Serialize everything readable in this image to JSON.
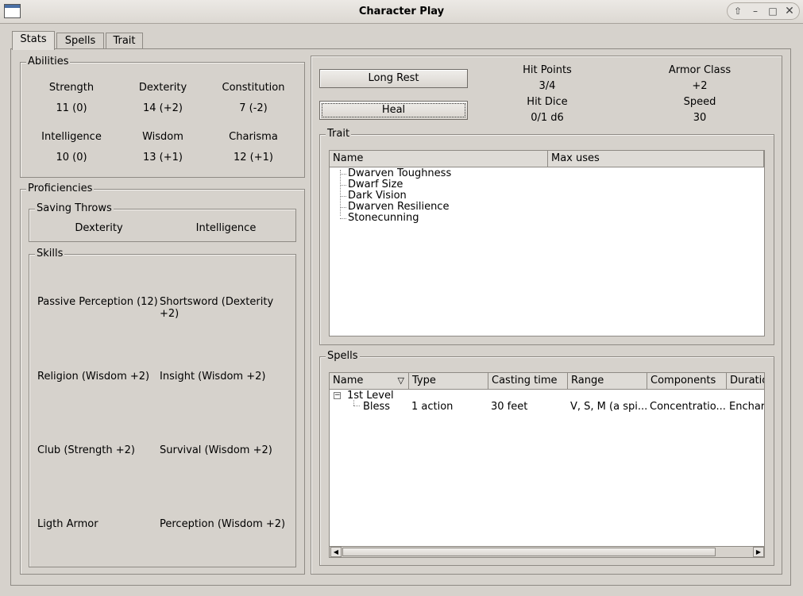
{
  "window": {
    "title": "Character Play"
  },
  "tabs": [
    {
      "label": "Stats"
    },
    {
      "label": "Spells"
    },
    {
      "label": "Trait"
    }
  ],
  "abilities": {
    "title": "Abilities",
    "items": [
      {
        "name": "Strength",
        "value": "11 (0)"
      },
      {
        "name": "Dexterity",
        "value": "14 (+2)"
      },
      {
        "name": "Constitution",
        "value": "7 (-2)"
      },
      {
        "name": "Intelligence",
        "value": "10 (0)"
      },
      {
        "name": "Wisdom",
        "value": "13 (+1)"
      },
      {
        "name": "Charisma",
        "value": "12 (+1)"
      }
    ]
  },
  "proficiencies": {
    "title": "Proficiencies",
    "saving_throws": {
      "title": "Saving Throws",
      "items": [
        "Dexterity",
        "Intelligence"
      ]
    },
    "skills": {
      "title": "Skills",
      "items": [
        "Passive Perception (12)",
        "Shortsword (Dexterity +2)",
        "Religion (Wisdom +2)",
        "Insight (Wisdom +2)",
        "Club (Strength +2)",
        "Survival (Wisdom +2)",
        "Ligth Armor",
        "Perception (Wisdom +2)"
      ]
    }
  },
  "actions": {
    "long_rest": "Long Rest",
    "heal": "Heal"
  },
  "status": {
    "hit_points_label": "Hit Points",
    "hit_points": "3/4",
    "armor_class_label": "Armor Class",
    "armor_class": "+2",
    "hit_dice_label": "Hit Dice",
    "hit_dice": "0/1 d6",
    "speed_label": "Speed",
    "speed": "30"
  },
  "trait_panel": {
    "title": "Trait",
    "columns": [
      "Name",
      "Max uses"
    ],
    "rows": [
      "Dwarven Toughness",
      "Dwarf Size",
      "Dark Vision",
      "Dwarven Resilience",
      "Stonecunning"
    ]
  },
  "spells_panel": {
    "title": "Spells",
    "columns": [
      "Name",
      "Type",
      "Casting time",
      "Range",
      "Components",
      "Duratio"
    ],
    "groups": [
      {
        "label": "1st Level",
        "spells": [
          {
            "name": "Bless",
            "type": "1 action",
            "casting_time": "30 feet",
            "range": "V, S, M (a spi...",
            "components": "Concentratio...",
            "duration": "Enchar"
          }
        ]
      }
    ]
  }
}
